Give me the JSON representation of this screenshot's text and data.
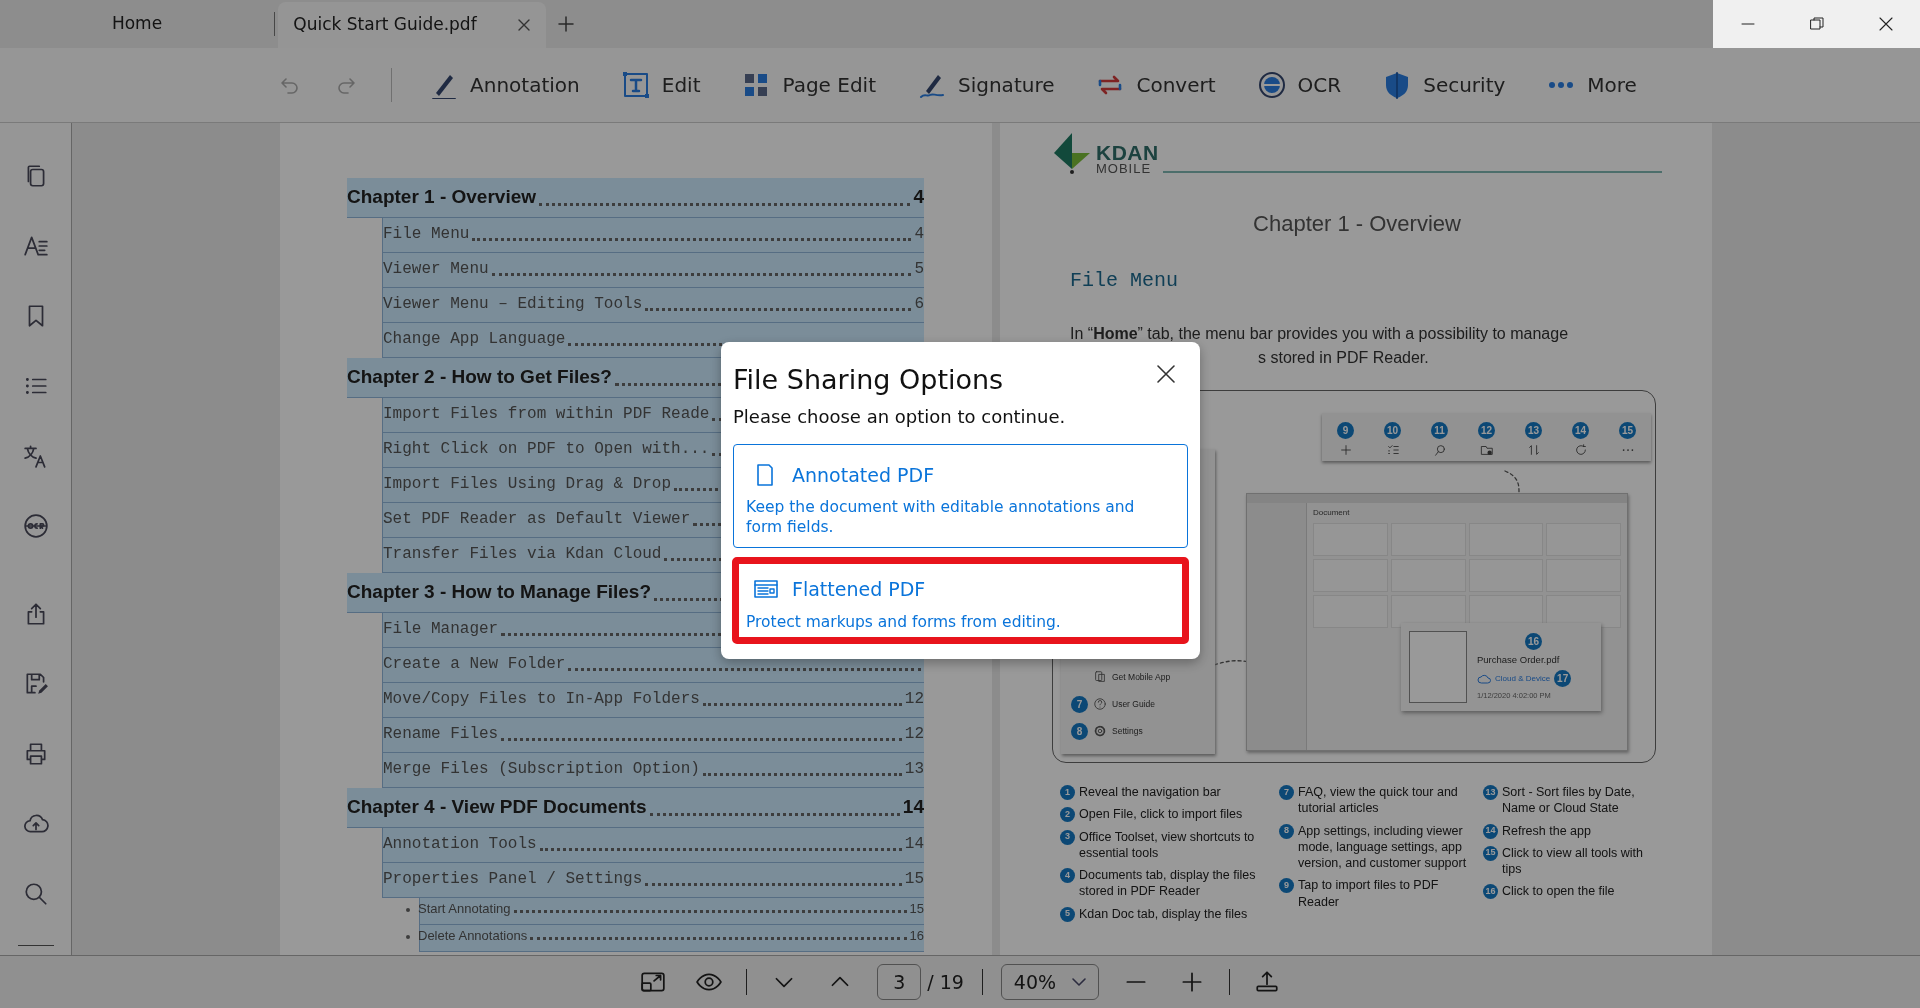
{
  "tabs": [
    {
      "label": "Home",
      "selected": false,
      "closable": false
    },
    {
      "label": "Quick Start Guide.pdf",
      "selected": true,
      "closable": true
    }
  ],
  "toolbar": {
    "items": [
      {
        "label": "Annotation"
      },
      {
        "label": "Edit"
      },
      {
        "label": "Page Edit"
      },
      {
        "label": "Signature"
      },
      {
        "label": "Convert"
      },
      {
        "label": "OCR"
      },
      {
        "label": "Security"
      },
      {
        "label": "More"
      }
    ]
  },
  "document": {
    "toc": [
      {
        "kind": "chapter",
        "title": "Chapter 1 - Overview",
        "page": "4",
        "selected": true
      },
      {
        "kind": "section",
        "title": "File Menu",
        "page": "4",
        "selected": true
      },
      {
        "kind": "section",
        "title": "Viewer Menu",
        "page": "5",
        "selected": true
      },
      {
        "kind": "section",
        "title": "Viewer Menu – Editing Tools",
        "page": "6",
        "selected": true
      },
      {
        "kind": "section",
        "title": "Change App Language",
        "selected": true
      },
      {
        "kind": "chapter",
        "title": "Chapter 2 - How to Get Files?",
        "selected": true
      },
      {
        "kind": "section",
        "title": "Import Files from within PDF Reade",
        "selected": true
      },
      {
        "kind": "section",
        "title": "Right Click on PDF to Open with...",
        "selected": true
      },
      {
        "kind": "section",
        "title": "Import Files Using Drag & Drop",
        "selected": true
      },
      {
        "kind": "section",
        "title": "Set PDF Reader as Default Viewer",
        "selected": true
      },
      {
        "kind": "section",
        "title": "Transfer Files via Kdan Cloud",
        "selected": true
      },
      {
        "kind": "chapter",
        "title": "Chapter 3 - How to Manage Files?",
        "selected": true
      },
      {
        "kind": "section",
        "title": "File Manager",
        "selected": true
      },
      {
        "kind": "section",
        "title": "Create a New Folder",
        "selected": true
      },
      {
        "kind": "section",
        "title": "Move/Copy Files to In-App Folders",
        "page": "12",
        "selected": true
      },
      {
        "kind": "section",
        "title": "Rename Files",
        "page": "12",
        "selected": true
      },
      {
        "kind": "section",
        "title": "Merge Files (Subscription Option)",
        "page": "13",
        "selected": true
      },
      {
        "kind": "chapter",
        "title": "Chapter 4 - View PDF Documents",
        "page": "14",
        "selected": true
      },
      {
        "kind": "section",
        "title": "Annotation Tools",
        "page": "14",
        "selected": true
      },
      {
        "kind": "section",
        "title": "Properties Panel / Settings",
        "page": "15",
        "selected": true
      },
      {
        "kind": "bullet",
        "title": "Start Annotating",
        "page": "15",
        "selected": true
      },
      {
        "kind": "bullet",
        "title": "Delete Annotations",
        "page": "16",
        "selected": true
      }
    ],
    "logo": {
      "name": "KDAN",
      "sub": "MOBILE"
    },
    "chapter_title": "Chapter 1 - Overview",
    "section_title": "File Menu",
    "paragraph_line_1": "In “**Home**” tab, the menu bar provides you with a possibility to manage",
    "paragraph_line_2": "s stored in PDF Reader.",
    "figure": {
      "toolbar_callouts": [
        "9",
        "10",
        "11",
        "12",
        "13",
        "14",
        "15"
      ],
      "window_label": "Document",
      "panel_items": [
        {
          "label": "Get Mobile App"
        },
        {
          "num": "7",
          "label": "User Guide"
        },
        {
          "num": "8",
          "label": "Settings"
        }
      ],
      "file_card": {
        "callout": "16",
        "name": "Purchase Order.pdf",
        "location": "Cloud & Device",
        "location_callout": "17",
        "date": "1/12/2020 4:02:00 PM"
      }
    },
    "legend": [
      [
        {
          "num": "1",
          "text": "Reveal the navigation bar"
        },
        {
          "num": "2",
          "text": "Open File, click to import files"
        },
        {
          "num": "3",
          "text": "Office Toolset, view shortcuts to essential tools"
        },
        {
          "num": "4",
          "text": "Documents tab, display the files stored in PDF Reader"
        },
        {
          "num": "5",
          "text": "Kdan Doc tab, display the files"
        }
      ],
      [
        {
          "num": "7",
          "text": "FAQ, view the quick tour and tutorial articles"
        },
        {
          "num": "8",
          "text": "App settings, including viewer mode, language settings, app version, and customer support"
        },
        {
          "num": "9",
          "text": "Tap to import files to PDF Reader"
        }
      ],
      [
        {
          "num": "13",
          "text": "Sort - Sort files by Date, Name or Cloud State"
        },
        {
          "num": "14",
          "text": "Refresh the app"
        },
        {
          "num": "15",
          "text": "Click to view all tools with tips"
        },
        {
          "num": "16",
          "text": "Click to open the file"
        }
      ]
    ]
  },
  "dialog": {
    "title": "File Sharing Options",
    "subtitle": "Please choose an option to continue.",
    "options": [
      {
        "kind": "annotated",
        "title": "Annotated PDF",
        "description": "Keep the document with editable annotations and form fields.",
        "selected": false
      },
      {
        "kind": "flattened",
        "title": "Flattened PDF",
        "description": "Protect markups and forms from editing.",
        "selected": true
      }
    ]
  },
  "status_bar": {
    "page": "3",
    "total": "/ 19",
    "zoom": "40%"
  }
}
